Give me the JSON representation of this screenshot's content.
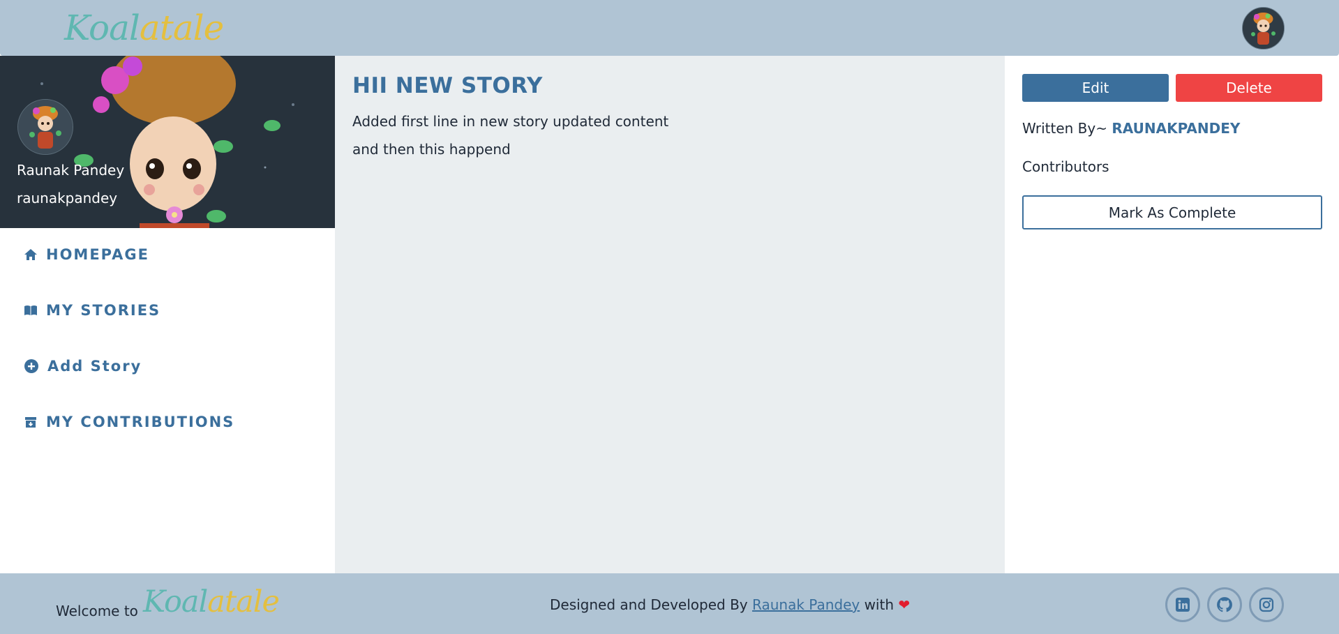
{
  "header": {
    "logo_part1": "Koal",
    "logo_part2": "atale",
    "user_avatar_icon": "user-avatar-icon"
  },
  "profile": {
    "display_name": "Raunak Pandey",
    "username": "raunakpandey"
  },
  "sidebar": {
    "items": [
      {
        "label": "HOMEPAGE",
        "icon": "home-icon"
      },
      {
        "label": "MY STORIES",
        "icon": "book-icon"
      },
      {
        "label": "Add Story",
        "icon": "plus-circle-icon"
      },
      {
        "label": "MY CONTRIBUTIONS",
        "icon": "archive-icon"
      }
    ]
  },
  "story": {
    "title": "HII NEW STORY",
    "lines": [
      "Added first line in new story updated content",
      "and then this happend"
    ]
  },
  "actions": {
    "edit_label": "Edit",
    "delete_label": "Delete",
    "written_by_label": "Written By~",
    "author": "RAUNAKPANDEY",
    "contributors_label": "Contributors",
    "complete_label": "Mark As Complete"
  },
  "footer": {
    "welcome": "Welcome to",
    "logo_part1": "Koal",
    "logo_part2": "atale",
    "credit_prefix": "Designed and Developed By",
    "credit_name": "Raunak Pandey",
    "credit_suffix": "with",
    "heart": "❤",
    "social": [
      "linkedin-icon",
      "github-icon",
      "instagram-icon"
    ]
  },
  "colors": {
    "header_bg": "#b0c4d4",
    "accent": "#3b6f9c",
    "danger": "#ef4444",
    "content_bg": "#eaeef0",
    "logo_teal": "#5fb7b1",
    "logo_gold": "#e4bf3f"
  }
}
